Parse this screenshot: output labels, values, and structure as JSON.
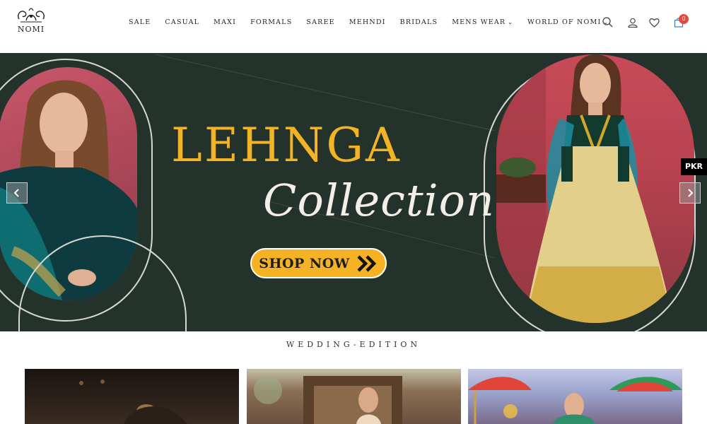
{
  "brand": {
    "logo_text": "NOMI"
  },
  "nav": {
    "items": [
      {
        "label": "SALE"
      },
      {
        "label": "CASUAL"
      },
      {
        "label": "MAXI"
      },
      {
        "label": "FORMALS"
      },
      {
        "label": "SAREE"
      },
      {
        "label": "MEHNDI"
      },
      {
        "label": "BRIDALS"
      },
      {
        "label": "MENS WEAR"
      },
      {
        "label": "WORLD OF NOMI"
      }
    ]
  },
  "header_icons": {
    "search": "search-icon",
    "account": "user-icon",
    "wishlist": "heart-icon",
    "cart": "shopping-bag-icon",
    "cart_count": "0"
  },
  "hero": {
    "headline": "LEHNGA",
    "script": "Collection",
    "cta_label": "SHOP NOW",
    "cta_icon": "double-chevron-right-icon",
    "prev_icon": "chevron-left-icon",
    "next_icon": "chevron-right-icon",
    "currency_label": "PKR",
    "background_color": "#23322a",
    "accent_color": "#f5b224"
  },
  "section": {
    "title": "WEDDING-EDITION"
  },
  "cards": [
    {
      "name": "wedding-card-1"
    },
    {
      "name": "wedding-card-2"
    },
    {
      "name": "wedding-card-3"
    }
  ]
}
